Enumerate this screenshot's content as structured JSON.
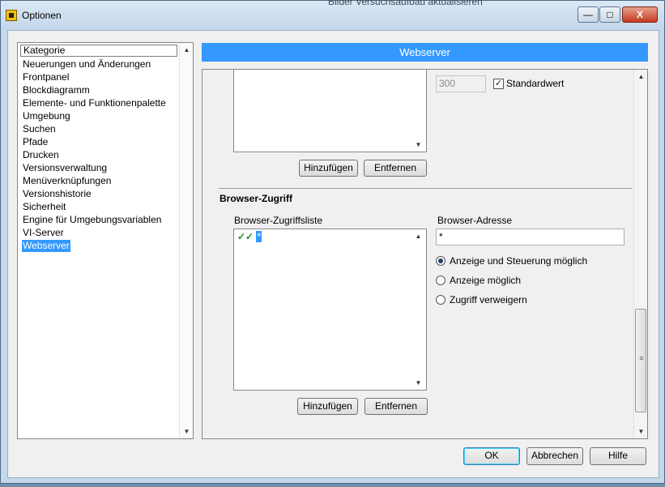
{
  "window": {
    "title": "Optionen",
    "behind_title": "Bilder Versuchsaufbau aktualisieren",
    "controls": {
      "minimize": "—",
      "maximize": "□",
      "close": "X"
    }
  },
  "categories": {
    "header": "Kategorie",
    "items": [
      "Neuerungen und Änderungen",
      "Frontpanel",
      "Blockdiagramm",
      "Elemente- und Funktionenpalette",
      "Umgebung",
      "Suchen",
      "Pfade",
      "Drucken",
      "Versionsverwaltung",
      "Menüverknüpfungen",
      "Versionshistorie",
      "Sicherheit",
      "Engine für Umgebungsvariablen",
      "VI-Server",
      "Webserver"
    ],
    "selected": "Webserver"
  },
  "panel": {
    "title": "Webserver",
    "upper": {
      "add_label": "Hinzufügen",
      "remove_label": "Entfernen",
      "timeout_value": "300",
      "default_checkbox_label": "Standardwert",
      "default_checked": true
    },
    "browser_access": {
      "heading": "Browser-Zugriff",
      "list_label": "Browser-Zugriffsliste",
      "list_entries": [
        {
          "icon": "double-check-icon",
          "text": "*",
          "selected": true
        }
      ],
      "add_label": "Hinzufügen",
      "remove_label": "Entfernen",
      "address_label": "Browser-Adresse",
      "address_value": "*",
      "options": [
        {
          "label": "Anzeige und Steuerung möglich",
          "selected": true
        },
        {
          "label": "Anzeige möglich",
          "selected": false
        },
        {
          "label": "Zugriff verweigern",
          "selected": false
        }
      ]
    }
  },
  "footer": {
    "ok_label": "OK",
    "cancel_label": "Abbrechen",
    "help_label": "Hilfe"
  },
  "icons": {
    "up": "▲",
    "down": "▼",
    "check": "✓",
    "double_check": "✓✓",
    "grip": "≡"
  }
}
